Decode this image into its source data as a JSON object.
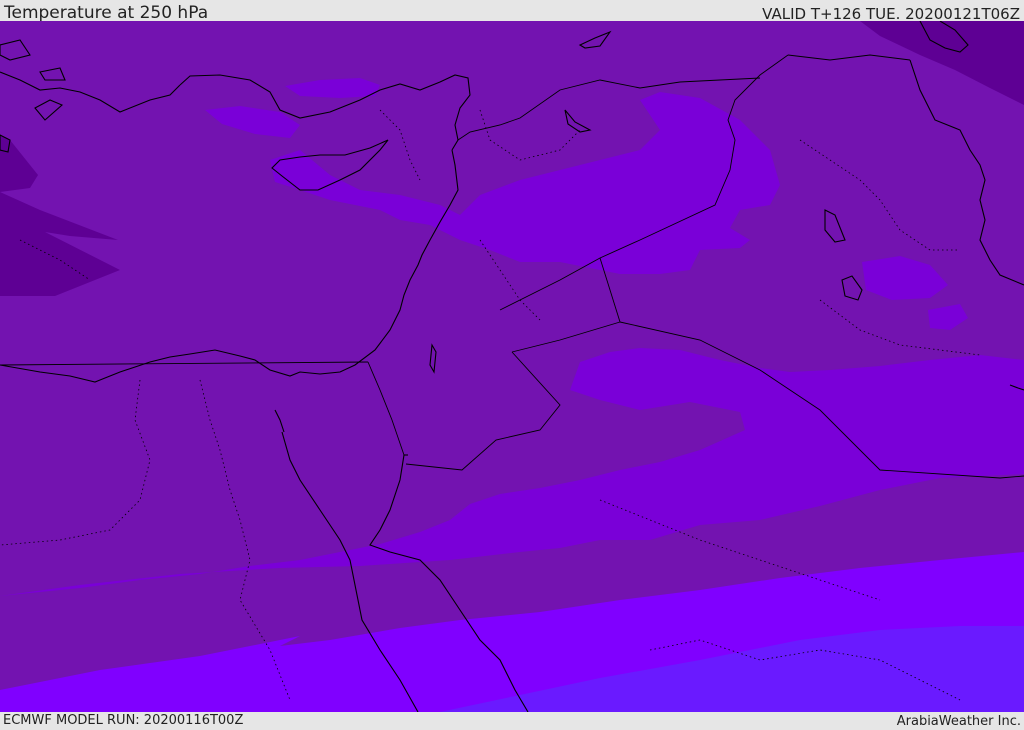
{
  "header": {
    "title": "Temperature at 250 hPa",
    "valid": "VALID T+126 TUE. 20200121T06Z"
  },
  "footer": {
    "model_run": "ECMWF MODEL RUN: 20200116T00Z",
    "credit": "ArabiaWeather Inc."
  },
  "colors": {
    "band_coldest": "#5e0094",
    "band_cold": "#7313b0",
    "band_mid": "#7a00d8",
    "band_warm": "#8000ff",
    "band_warmest": "#6a1aff",
    "coastline": "#000000",
    "border": "#000000"
  }
}
